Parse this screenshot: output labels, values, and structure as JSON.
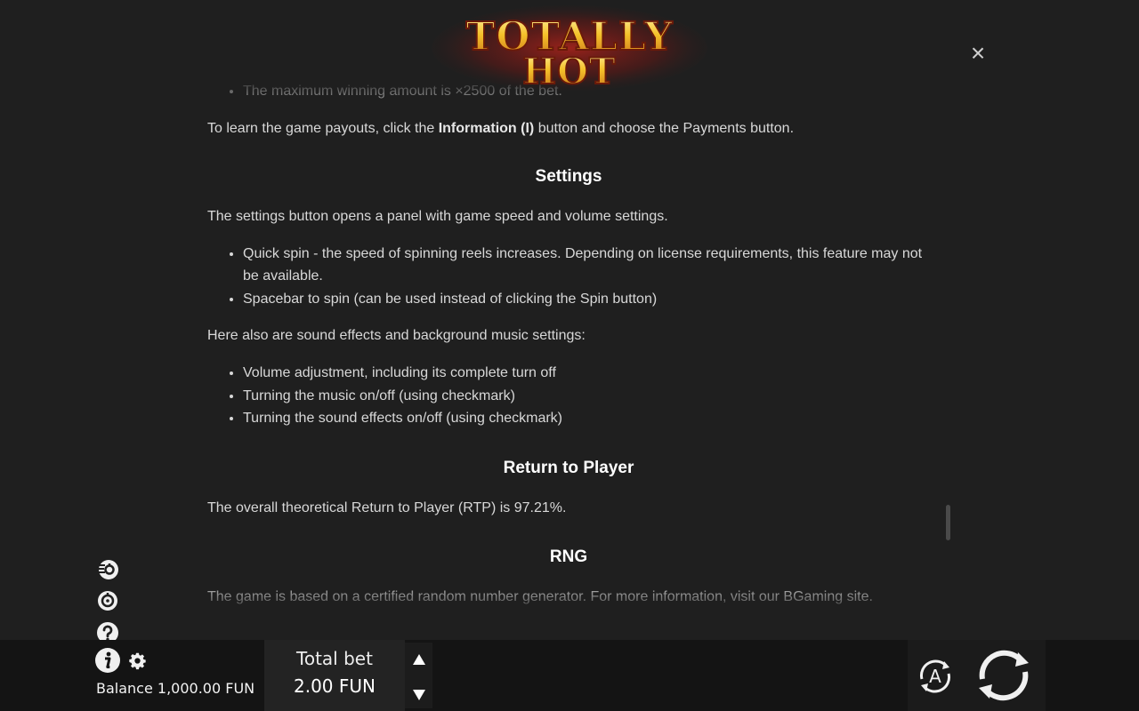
{
  "logo": {
    "line1": "TOTALLY",
    "line2": "HOT"
  },
  "close": {
    "label": "×"
  },
  "rules": {
    "partial_bullet": "The maximum winning amount is ×2500 of the bet.",
    "payouts_pre": "To learn the game payouts, click the ",
    "payouts_bold": "Information (I)",
    "payouts_post": " button and choose the Payments button.",
    "settings_heading": "Settings",
    "settings_intro": "The settings button opens a panel with game speed and volume settings.",
    "settings_items": [
      "Quick spin - the speed of spinning reels increases. Depending on license requirements, this feature may not be available.",
      "Spacebar to spin (can be used instead of clicking the Spin button)"
    ],
    "sound_intro": "Here also are sound effects and background music settings:",
    "sound_items": [
      "Volume adjustment, including its complete turn off",
      "Turning the music on/off (using checkmark)",
      "Turning the sound effects on/off (using checkmark)"
    ],
    "rtp_heading": "Return to Player",
    "rtp_text": "The overall theoretical Return to Player (RTP) is 97.21%.",
    "rng_heading": "RNG",
    "rng_text": "The game is based on a certified random number generator. For more information, visit our BGaming site."
  },
  "side_icons": [
    "quick-spin-icon",
    "sound-icon",
    "help-icon"
  ],
  "bottom": {
    "balance_label": "Balance",
    "balance_value": "1,000.00 FUN",
    "bet_label": "Total bet",
    "bet_value": "2.00 FUN",
    "auto_label": "A"
  },
  "colors": {
    "background": "#1f1f1f",
    "bar": "#141414",
    "logo_fire": "#e8541a",
    "logo_gold": "#f5c12a"
  }
}
